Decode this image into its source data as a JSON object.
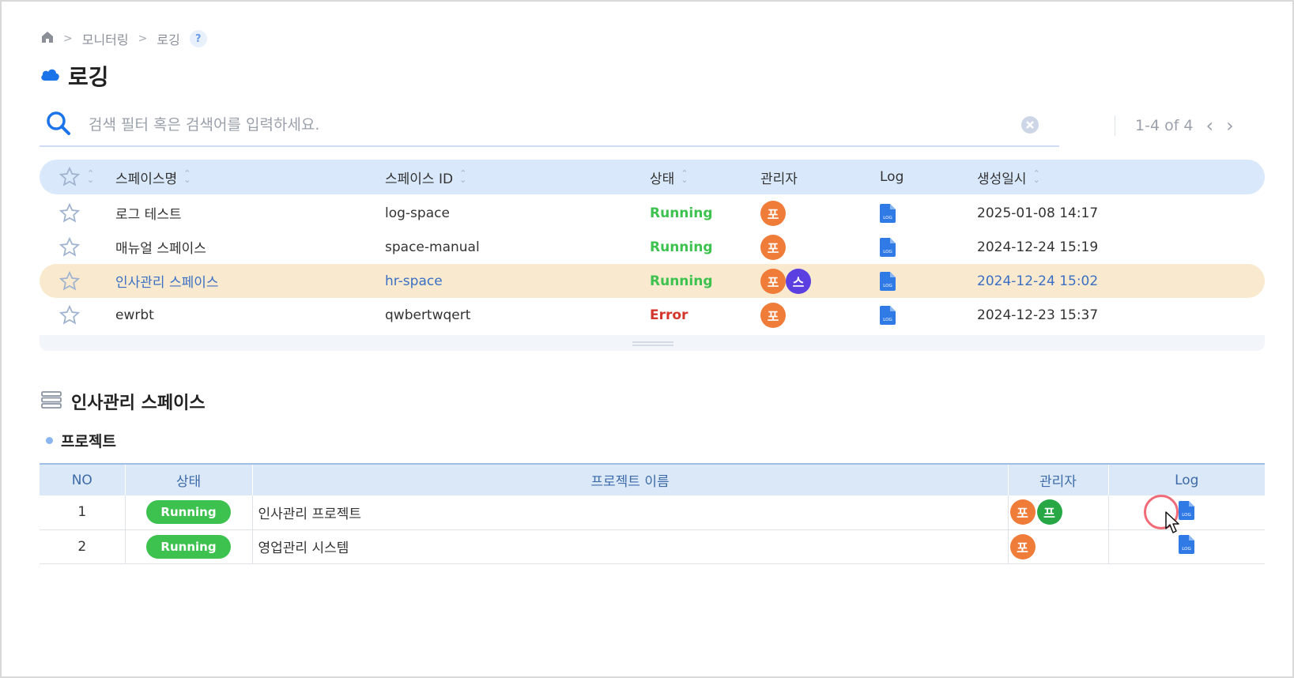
{
  "breadcrumb": {
    "items": [
      "모니터링",
      "로깅"
    ],
    "help": "?"
  },
  "page": {
    "title": "로깅"
  },
  "search": {
    "placeholder": "검색 필터 혹은 검색어를 입력하세요.",
    "value": ""
  },
  "pager": {
    "text": "1-4 of 4",
    "prev": "‹",
    "next": "›"
  },
  "space_table": {
    "headers": {
      "name": "스페이스명",
      "id": "스페이스 ID",
      "status": "상태",
      "admin": "관리자",
      "log": "Log",
      "created": "생성일시"
    },
    "rows": [
      {
        "name": "로그 테스트",
        "id": "log-space",
        "status": "Running",
        "admins": [
          "포"
        ],
        "created": "2025-01-08 14:17"
      },
      {
        "name": "매뉴얼 스페이스",
        "id": "space-manual",
        "status": "Running",
        "admins": [
          "포"
        ],
        "created": "2024-12-24 15:19"
      },
      {
        "name": "인사관리 스페이스",
        "id": "hr-space",
        "status": "Running",
        "admins": [
          "포",
          "스"
        ],
        "created": "2024-12-24 15:02",
        "selected": true
      },
      {
        "name": "ewrbt",
        "id": "qwbertwqert",
        "status": "Error",
        "admins": [
          "포"
        ],
        "created": "2024-12-23 15:37"
      }
    ]
  },
  "detail": {
    "title": "인사관리 스페이스",
    "section": "프로젝트",
    "headers": {
      "no": "NO",
      "status": "상태",
      "name": "프로젝트 이름",
      "admin": "관리자",
      "log": "Log"
    },
    "rows": [
      {
        "no": "1",
        "status": "Running",
        "name": "인사관리 프로젝트",
        "admins": [
          "포",
          "프"
        ]
      },
      {
        "no": "2",
        "status": "Running",
        "name": "영업관리 시스템",
        "admins": [
          "포"
        ]
      }
    ]
  },
  "colors": {
    "accent": "#1a73e8",
    "running": "#3ec24f",
    "error": "#d4362b",
    "selected_row": "#f9eacf",
    "header_bg": "#d9e8fb",
    "avatar_orange": "#f07c3a",
    "avatar_purple": "#5b3fe0",
    "avatar_green": "#27a745"
  },
  "icons": {
    "home": "home-icon",
    "cloud": "cloud-icon",
    "search": "search-icon",
    "clear": "clear-icon",
    "star": "star-icon",
    "log": "log-file-icon",
    "server": "server-icon",
    "cursor": "cursor-icon"
  }
}
